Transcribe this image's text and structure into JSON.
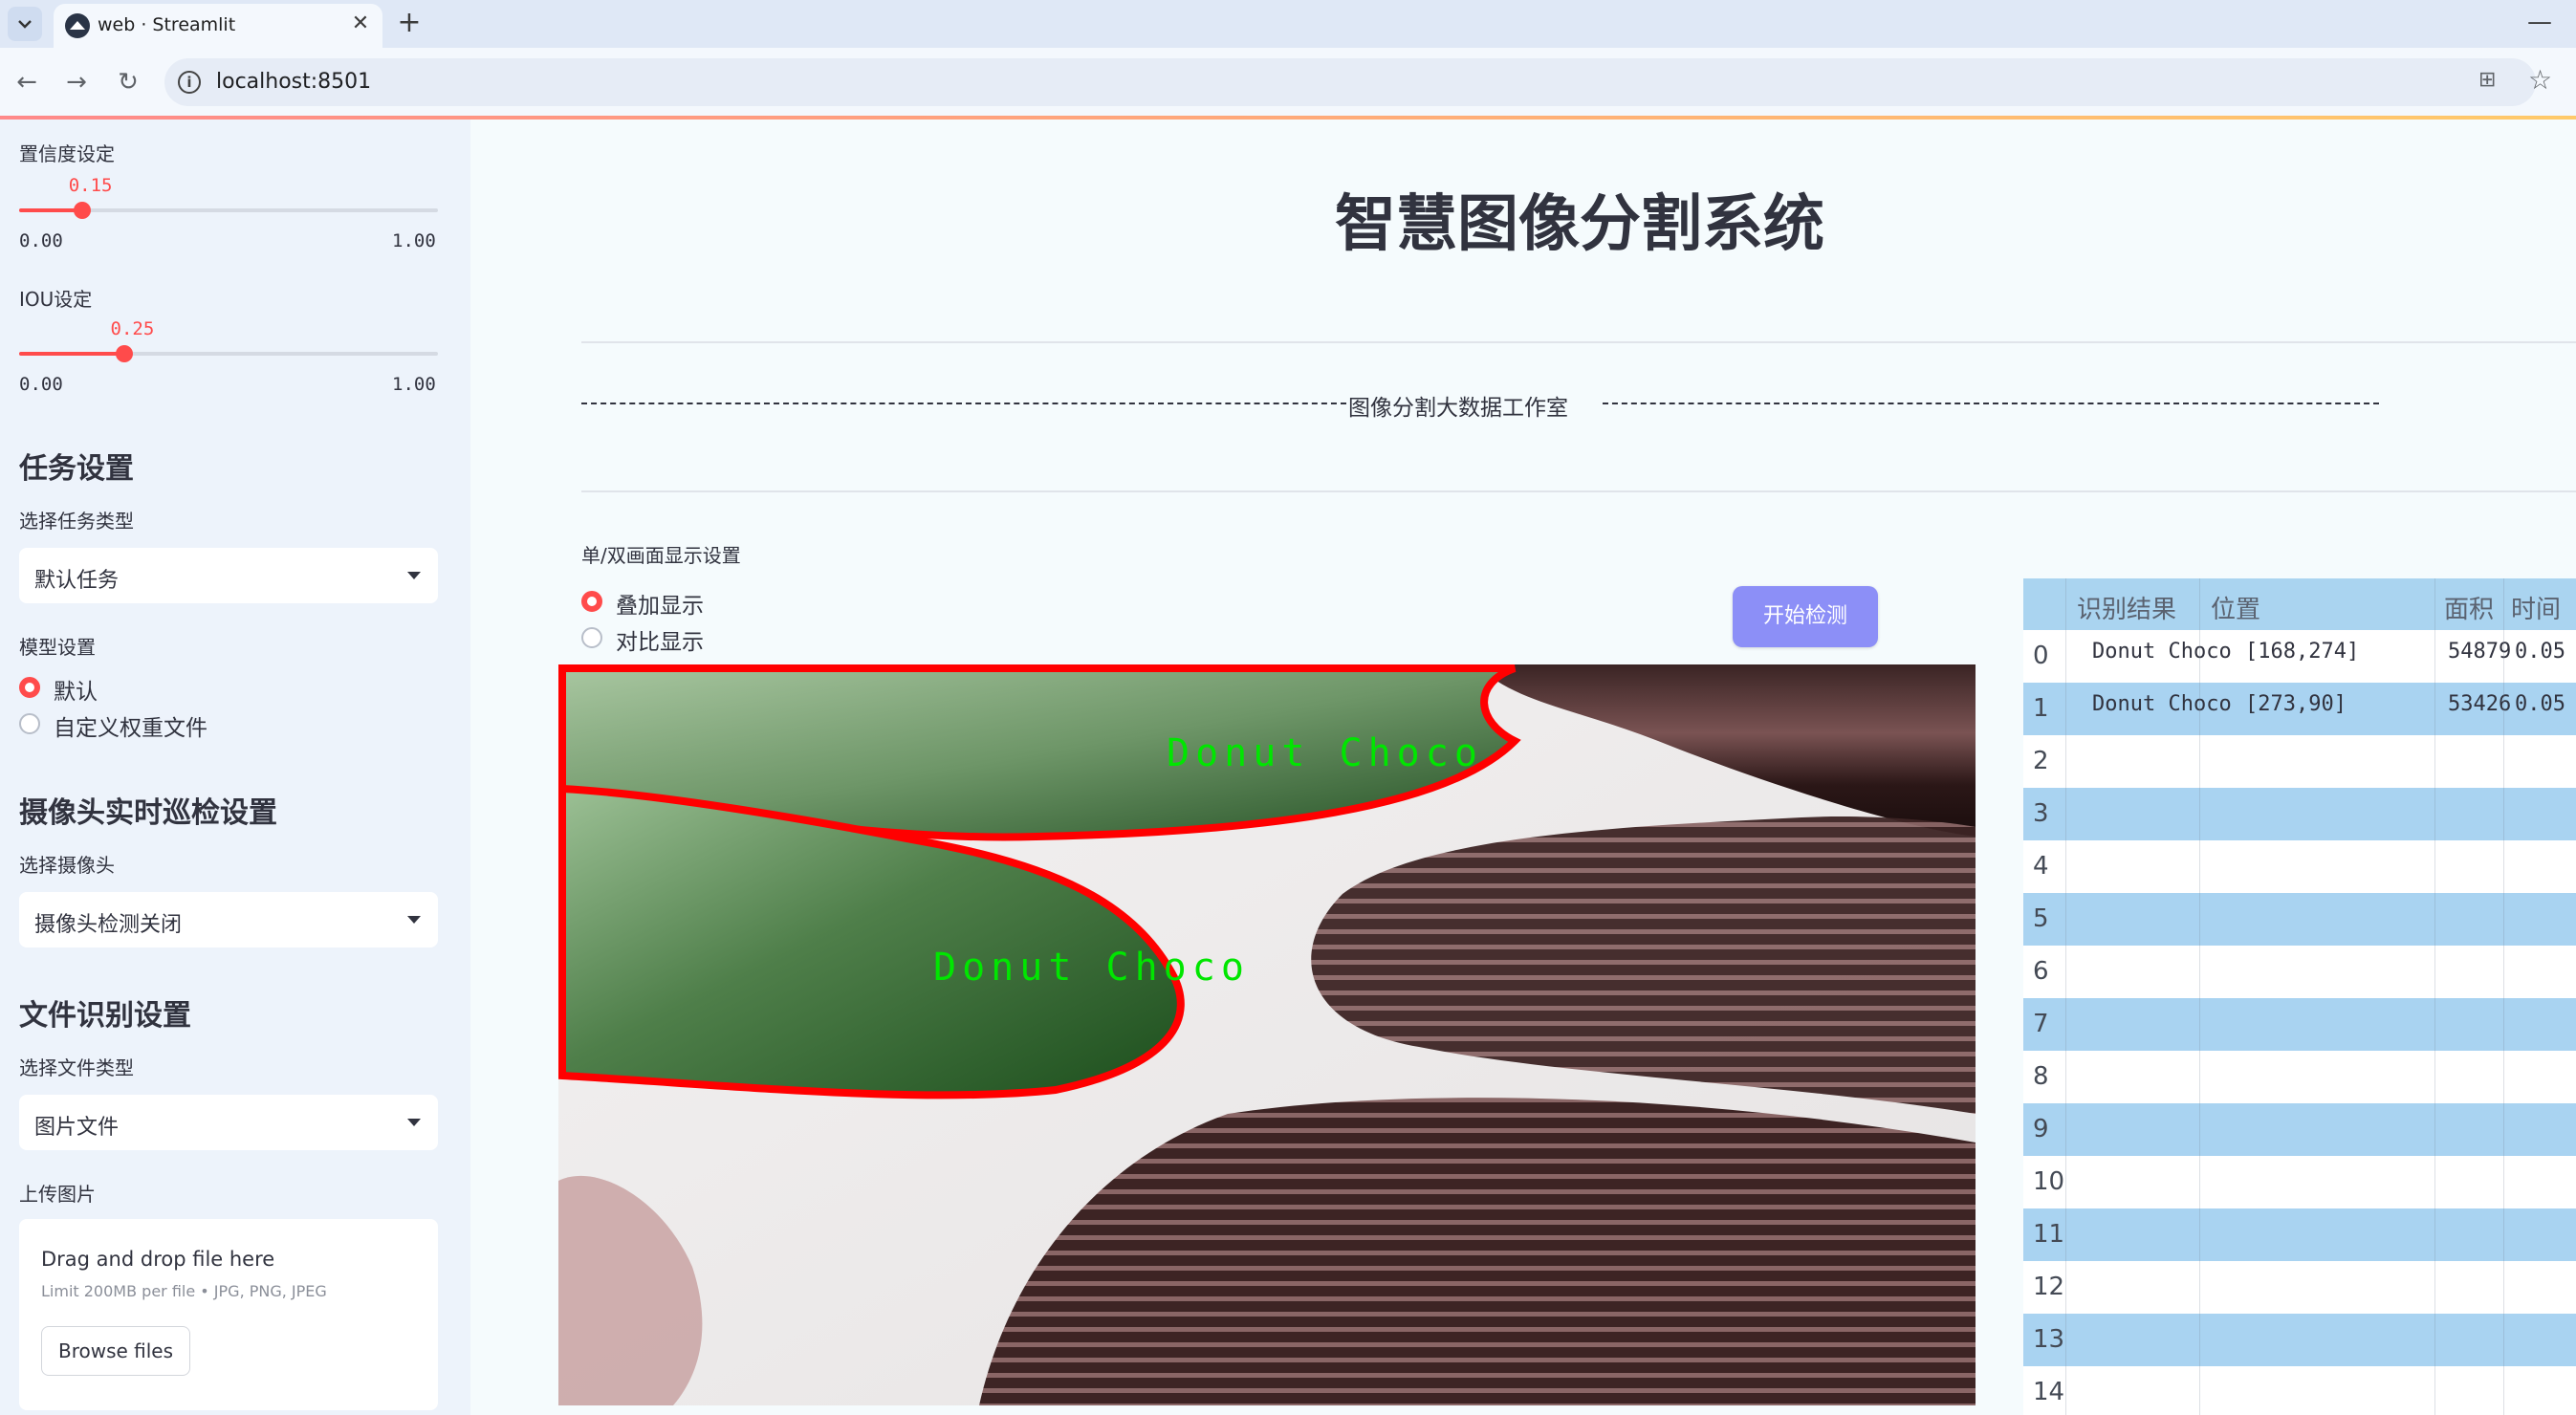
{
  "browser": {
    "tab_title": "web · Streamlit",
    "tab_close": "✕",
    "tab_new": "+",
    "window_minimize": "—",
    "url": "localhost:8501"
  },
  "sidebar": {
    "confidence": {
      "label": "置信度设定",
      "value": "0.15",
      "fraction": 0.15,
      "min": "0.00",
      "max": "1.00"
    },
    "iou": {
      "label": "IOU设定",
      "value": "0.25",
      "fraction": 0.25,
      "min": "0.00",
      "max": "1.00"
    },
    "task_header": "任务设置",
    "task_type_label": "选择任务类型",
    "task_type_value": "默认任务",
    "model_label": "模型设置",
    "model_options": [
      "默认",
      "自定义权重文件"
    ],
    "model_selected": "默认",
    "camera_header": "摄像头实时巡检设置",
    "camera_label": "选择摄像头",
    "camera_value": "摄像头检测关闭",
    "file_header": "文件识别设置",
    "file_type_label": "选择文件类型",
    "file_type_value": "图片文件",
    "upload_label": "上传图片",
    "upload_main": "Drag and drop file here",
    "upload_sub": "Limit 200MB per file • JPG, PNG, JPEG",
    "upload_button": "Browse files"
  },
  "main": {
    "title": "智慧图像分割系统",
    "subtitle": "图像分割大数据工作室",
    "display_mode_label": "单/双画面显示设置",
    "display_modes": [
      "叠加显示",
      "对比显示"
    ],
    "display_selected": "叠加显示",
    "detect_button": "开始检测",
    "overlay_labels": [
      "Donut Choco",
      "Donut Choco"
    ]
  },
  "table": {
    "columns": [
      "识别结果",
      "位置",
      "面积",
      "时间"
    ],
    "rows": [
      {
        "index": "0",
        "result": "Donut Choco",
        "position": "[168,274]",
        "area": "54879",
        "time": "0.05"
      },
      {
        "index": "1",
        "result": "Donut Choco",
        "position": "[273,90]",
        "area": "53426",
        "time": "0.05"
      },
      {
        "index": "2"
      },
      {
        "index": "3"
      },
      {
        "index": "4"
      },
      {
        "index": "5"
      },
      {
        "index": "6"
      },
      {
        "index": "7"
      },
      {
        "index": "8"
      },
      {
        "index": "9"
      },
      {
        "index": "10"
      },
      {
        "index": "11"
      },
      {
        "index": "12"
      },
      {
        "index": "13"
      },
      {
        "index": "14"
      }
    ]
  },
  "colors": {
    "accent": "#ff4b4b",
    "detect_button": "#8c8ff7",
    "segmentation_outline": "#ff0000",
    "segmentation_fill": "#1f5a1f",
    "label_text": "#00e600",
    "table_header": "#aad4f0",
    "table_stripe": "#a9d3f1"
  },
  "icons": [
    "tab-search-icon",
    "streamlit-icon",
    "back-arrow-icon",
    "forward-arrow-icon",
    "reload-icon",
    "site-info-icon",
    "translate-icon",
    "bookmark-star-icon",
    "dropdown-caret-icon"
  ]
}
